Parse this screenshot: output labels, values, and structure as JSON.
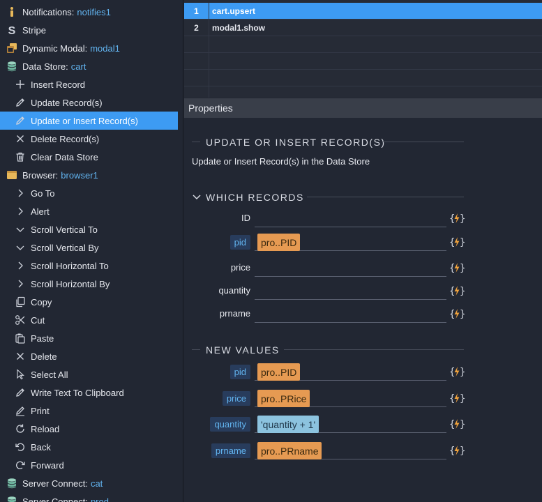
{
  "tree": {
    "items": [
      {
        "label": "Notifications:",
        "value": "notifies1",
        "icon": "info-icon",
        "level": 0
      },
      {
        "label": "Stripe",
        "value": "",
        "icon": "stripe-icon",
        "level": 0
      },
      {
        "label": "Dynamic Modal:",
        "value": "modal1",
        "icon": "modal-icon",
        "level": 0
      },
      {
        "label": "Data Store:",
        "value": "cart",
        "icon": "database-icon",
        "level": 0
      },
      {
        "label": "Insert Record",
        "value": "",
        "icon": "plus-icon",
        "level": 1
      },
      {
        "label": "Update Record(s)",
        "value": "",
        "icon": "pencil-icon",
        "level": 1
      },
      {
        "label": "Update or Insert Record(s)",
        "value": "",
        "icon": "pencil-icon",
        "level": 1,
        "selected": true
      },
      {
        "label": "Delete Record(s)",
        "value": "",
        "icon": "close-icon",
        "level": 1
      },
      {
        "label": "Clear Data Store",
        "value": "",
        "icon": "trash-icon",
        "level": 1
      },
      {
        "label": "Browser:",
        "value": "browser1",
        "icon": "browser-icon",
        "level": 0
      },
      {
        "label": "Go To",
        "value": "",
        "icon": "chevron-right-icon",
        "level": 1
      },
      {
        "label": "Alert",
        "value": "",
        "icon": "chevron-right-icon",
        "level": 1
      },
      {
        "label": "Scroll Vertical To",
        "value": "",
        "icon": "chevron-down-icon",
        "level": 1
      },
      {
        "label": "Scroll Vertical By",
        "value": "",
        "icon": "chevron-down-icon",
        "level": 1
      },
      {
        "label": "Scroll Horizontal To",
        "value": "",
        "icon": "chevron-right-icon",
        "level": 1
      },
      {
        "label": "Scroll Horizontal By",
        "value": "",
        "icon": "chevron-right-icon",
        "level": 1
      },
      {
        "label": "Copy",
        "value": "",
        "icon": "copy-icon",
        "level": 1
      },
      {
        "label": "Cut",
        "value": "",
        "icon": "scissors-icon",
        "level": 1
      },
      {
        "label": "Paste",
        "value": "",
        "icon": "paste-icon",
        "level": 1
      },
      {
        "label": "Delete",
        "value": "",
        "icon": "close-icon",
        "level": 1
      },
      {
        "label": "Select All",
        "value": "",
        "icon": "cursor-icon",
        "level": 1
      },
      {
        "label": "Write Text To Clipboard",
        "value": "",
        "icon": "pencil-icon",
        "level": 1
      },
      {
        "label": "Print",
        "value": "",
        "icon": "print-icon",
        "level": 1
      },
      {
        "label": "Reload",
        "value": "",
        "icon": "reload-icon",
        "level": 1
      },
      {
        "label": "Back",
        "value": "",
        "icon": "back-icon",
        "level": 1
      },
      {
        "label": "Forward",
        "value": "",
        "icon": "forward-icon",
        "level": 1
      },
      {
        "label": "Server Connect:",
        "value": "cat",
        "icon": "database-icon",
        "level": 0
      },
      {
        "label": "Server Connect:",
        "value": "prod",
        "icon": "database-icon",
        "level": 0
      }
    ]
  },
  "steps": [
    {
      "num": "1",
      "name": "cart.upsert",
      "active": true
    },
    {
      "num": "2",
      "name": "modal1.show",
      "active": false
    }
  ],
  "properties": {
    "title": "Properties",
    "section_title": "UPDATE OR INSERT RECORD(S)",
    "description": "Update or Insert Record(s) in the Data Store",
    "which_records": {
      "title": "WHICH RECORDS",
      "fields": [
        {
          "label": "ID",
          "tag": false,
          "value": ""
        },
        {
          "label": "pid",
          "tag": true,
          "value": "pro..PID",
          "chip": "orange"
        },
        {
          "label": "price",
          "tag": false,
          "value": ""
        },
        {
          "label": "quantity",
          "tag": false,
          "value": ""
        },
        {
          "label": "prname",
          "tag": false,
          "value": ""
        }
      ]
    },
    "new_values": {
      "title": "NEW VALUES",
      "fields": [
        {
          "label": "pid",
          "tag": true,
          "value": "pro..PID",
          "chip": "orange"
        },
        {
          "label": "price",
          "tag": true,
          "value": "pro..PRice",
          "chip": "orange"
        },
        {
          "label": "quantity",
          "tag": true,
          "value": "'quantity + 1'",
          "chip": "blue"
        },
        {
          "label": "prname",
          "tag": true,
          "value": "pro..PRname",
          "chip": "orange"
        }
      ]
    },
    "dynamic_icon": "dynamic-data-icon"
  },
  "colors": {
    "accent": "#3d9bf3",
    "value_text": "#62b4f0",
    "chip_orange": "#e69a52",
    "chip_blue": "#8cc3df",
    "dynamic_icon_braces": "#cfd3dc",
    "dynamic_icon_bolt": "#f0a23c"
  }
}
